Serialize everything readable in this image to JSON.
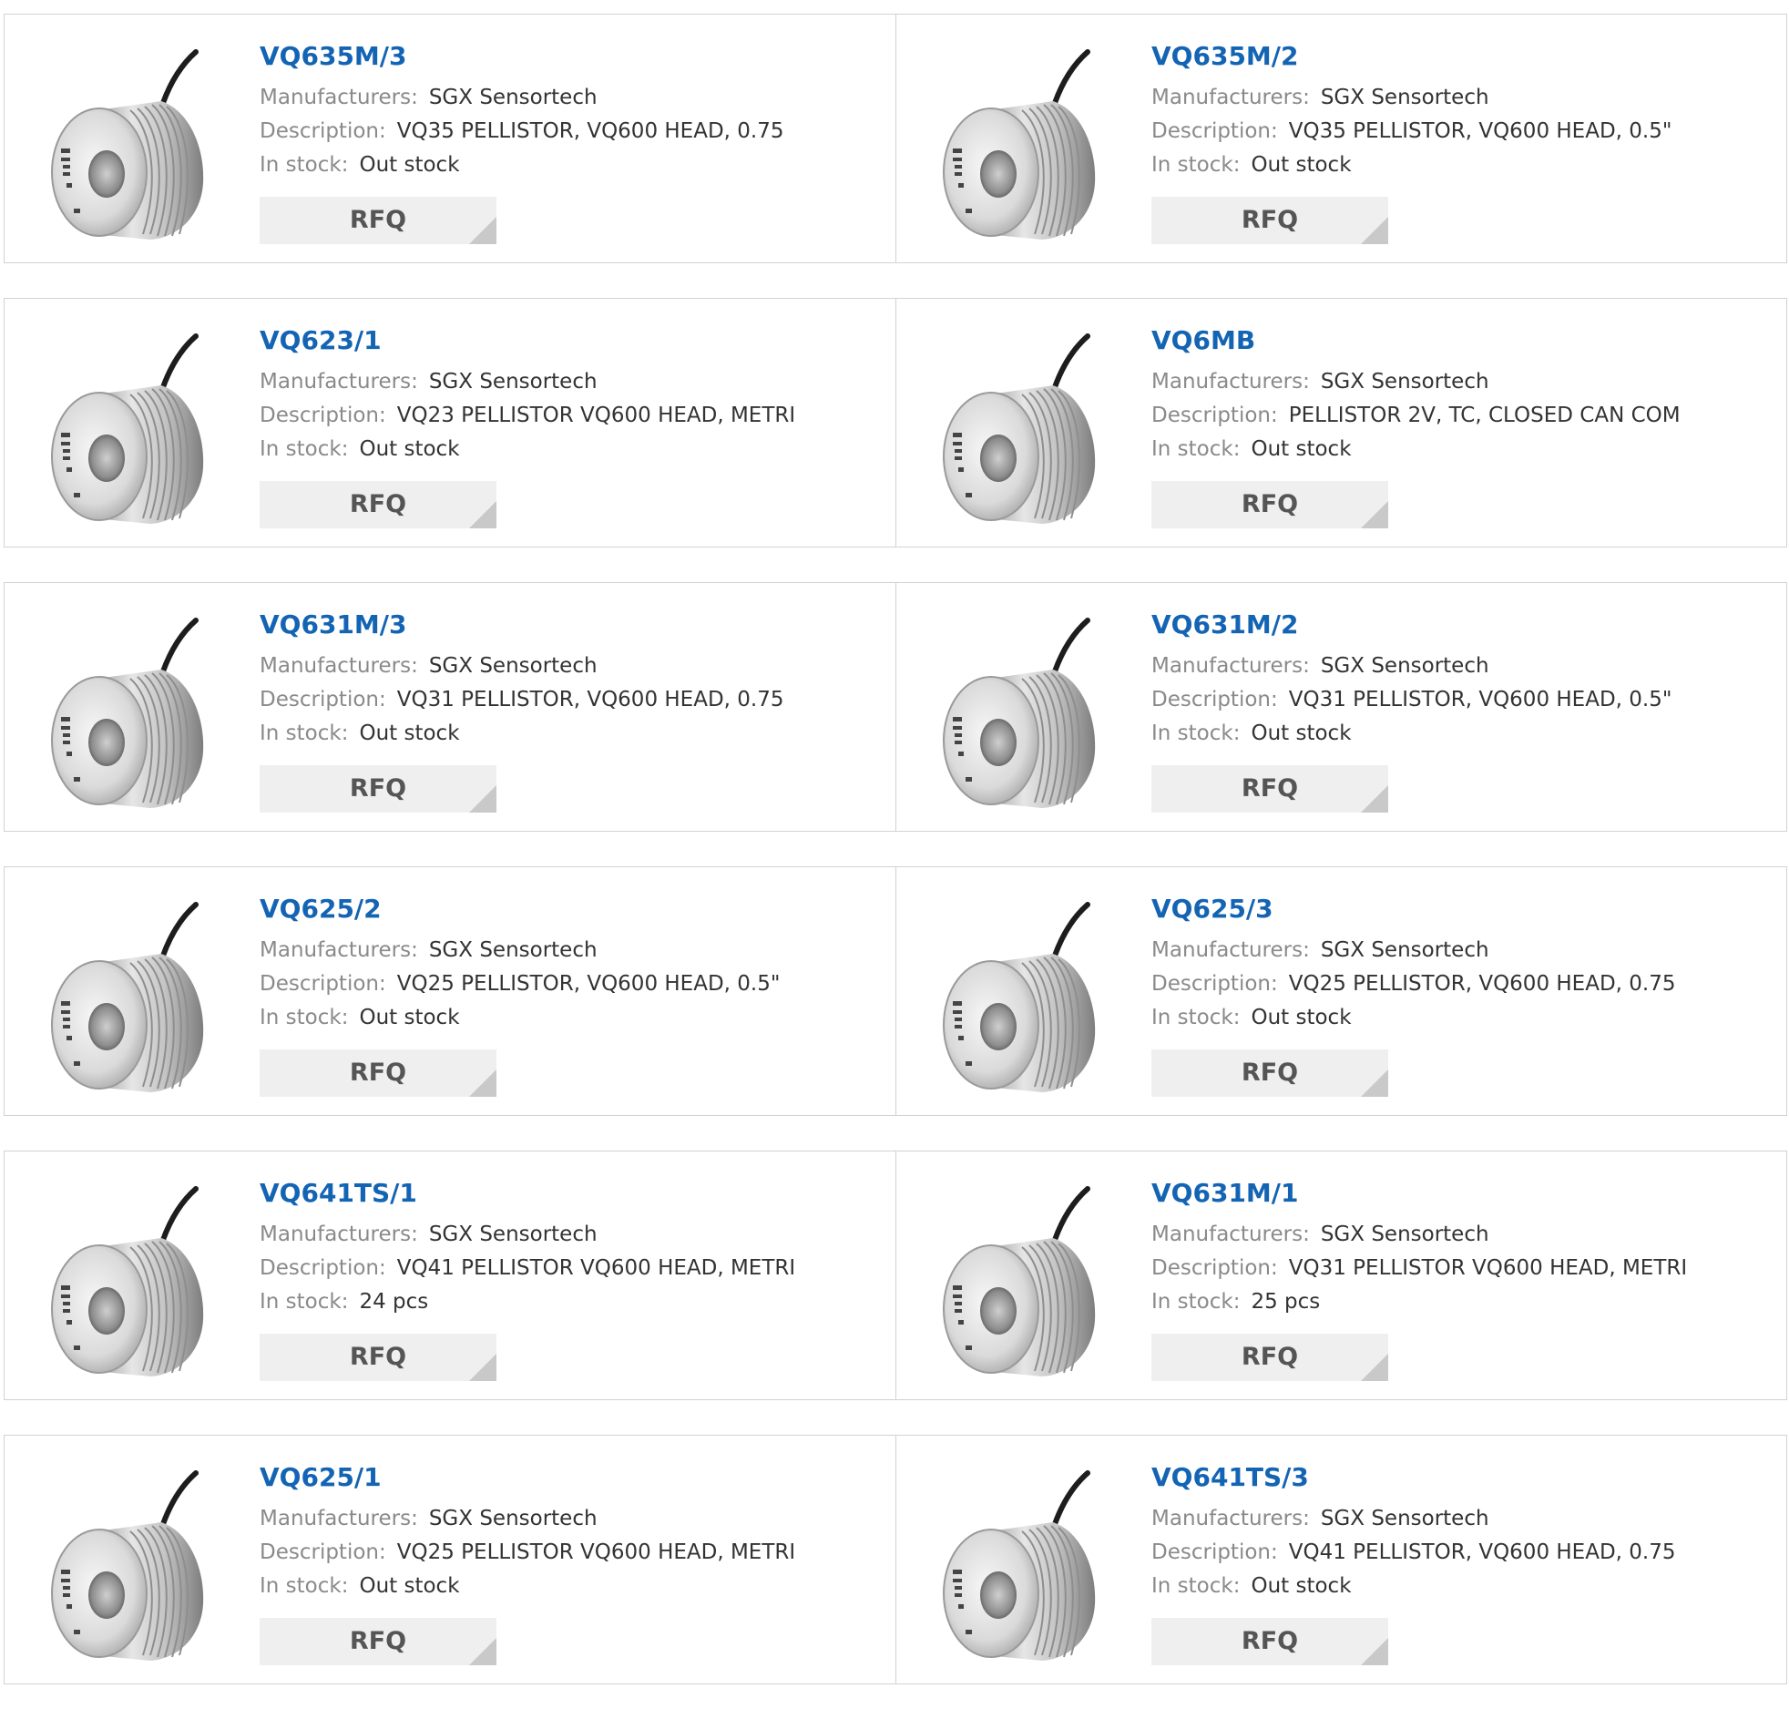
{
  "labels": {
    "manufacturer": "Manufacturers:",
    "description": "Description:",
    "stock": "In stock:",
    "rfq": "RFQ"
  },
  "image": {
    "icon": "pellistor-sensor-product-photo"
  },
  "colors": {
    "title_link": "#1464b4",
    "label_grey": "#8a8a8a",
    "button_bg": "#efefef",
    "border": "#d2d2d2"
  },
  "products": [
    {
      "title": "VQ635M/3",
      "manufacturer": "SGX Sensortech",
      "description": "VQ35 PELLISTOR, VQ600 HEAD, 0.75",
      "stock": "Out stock"
    },
    {
      "title": "VQ635M/2",
      "manufacturer": "SGX Sensortech",
      "description": "VQ35 PELLISTOR, VQ600 HEAD, 0.5\"",
      "stock": "Out stock"
    },
    {
      "title": "VQ623/1",
      "manufacturer": "SGX Sensortech",
      "description": "VQ23 PELLISTOR VQ600 HEAD, METRI",
      "stock": "Out stock"
    },
    {
      "title": "VQ6MB",
      "manufacturer": "SGX Sensortech",
      "description": "PELLISTOR 2V, TC, CLOSED CAN COM",
      "stock": "Out stock"
    },
    {
      "title": "VQ631M/3",
      "manufacturer": "SGX Sensortech",
      "description": "VQ31 PELLISTOR, VQ600 HEAD, 0.75",
      "stock": "Out stock"
    },
    {
      "title": "VQ631M/2",
      "manufacturer": "SGX Sensortech",
      "description": "VQ31 PELLISTOR, VQ600 HEAD, 0.5\"",
      "stock": "Out stock"
    },
    {
      "title": "VQ625/2",
      "manufacturer": "SGX Sensortech",
      "description": "VQ25 PELLISTOR, VQ600 HEAD, 0.5\"",
      "stock": "Out stock"
    },
    {
      "title": "VQ625/3",
      "manufacturer": "SGX Sensortech",
      "description": "VQ25 PELLISTOR, VQ600 HEAD, 0.75",
      "stock": "Out stock"
    },
    {
      "title": "VQ641TS/1",
      "manufacturer": "SGX Sensortech",
      "description": "VQ41 PELLISTOR VQ600 HEAD, METRI",
      "stock": "24 pcs"
    },
    {
      "title": "VQ631M/1",
      "manufacturer": "SGX Sensortech",
      "description": "VQ31 PELLISTOR VQ600 HEAD, METRI",
      "stock": "25 pcs"
    },
    {
      "title": "VQ625/1",
      "manufacturer": "SGX Sensortech",
      "description": "VQ25 PELLISTOR VQ600 HEAD, METRI",
      "stock": "Out stock"
    },
    {
      "title": "VQ641TS/3",
      "manufacturer": "SGX Sensortech",
      "description": "VQ41 PELLISTOR, VQ600 HEAD, 0.75",
      "stock": "Out stock"
    }
  ]
}
